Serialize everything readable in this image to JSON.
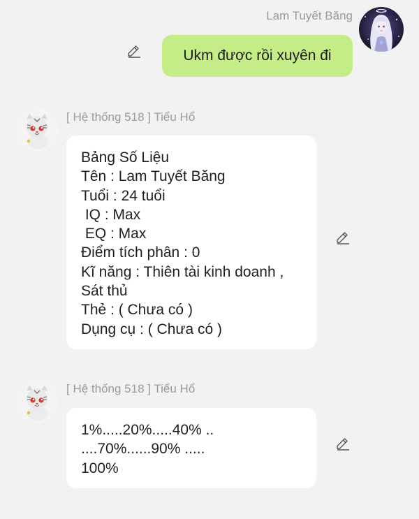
{
  "sender": {
    "name": "Lam Tuyết Băng",
    "message": "Ukm được rồi xuyên đi"
  },
  "messages": [
    {
      "name": "[ Hệ thống 518 ] Tiểu Hổ",
      "lines": [
        "Bảng Số Liệu",
        "Tên : Lam Tuyết Băng",
        "Tuổi : 24 tuổi",
        " IQ : Max",
        " EQ : Max",
        "Điểm tích phân : 0",
        "Kĩ năng : Thiên tài kinh doanh ,",
        "Sát thủ",
        "Thẻ : ( Chưa có )",
        "Dụng cụ : ( Chưa có )"
      ]
    },
    {
      "name": "[ Hệ thống 518 ] Tiểu Hổ",
      "lines": [
        "1%.....20%.....40% ..",
        "....70%......90% .....",
        "100%"
      ]
    }
  ],
  "icons": {
    "edit": "pencil-icon",
    "sender_avatar": "girl-avatar",
    "bot_avatar": "tiger-cub-avatar"
  },
  "colors": {
    "background": "#f2f2f2",
    "sent_bubble": "#c5ed87",
    "received_bubble": "#ffffff",
    "name_text": "#9a9a9a"
  }
}
